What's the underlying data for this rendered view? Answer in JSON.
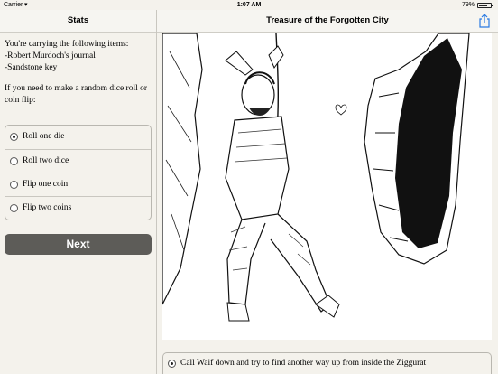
{
  "status_bar": {
    "carrier": "Carrier",
    "time": "1:07 AM",
    "battery": "79%",
    "battery_level": 0.79
  },
  "left_header": {
    "title": "Stats"
  },
  "right_header": {
    "title": "Treasure of the Forgotten City",
    "share_icon": "share-icon"
  },
  "inventory": {
    "intro": "You're carrying the following items:",
    "items": [
      "-Robert Murdoch's journal",
      "-Sandstone key"
    ]
  },
  "dice": {
    "prompt": "If you need to make a random dice roll or coin flip:",
    "options": [
      {
        "label": "Roll one die",
        "selected": true
      },
      {
        "label": "Roll two dice",
        "selected": false
      },
      {
        "label": "Flip one coin",
        "selected": false
      },
      {
        "label": "Flip two coins",
        "selected": false
      }
    ]
  },
  "next_button": {
    "label": "Next"
  },
  "story": {
    "choices": [
      {
        "label": "Call Waif down and try to find another way up from inside the Ziggurat",
        "selected": true
      }
    ]
  }
}
